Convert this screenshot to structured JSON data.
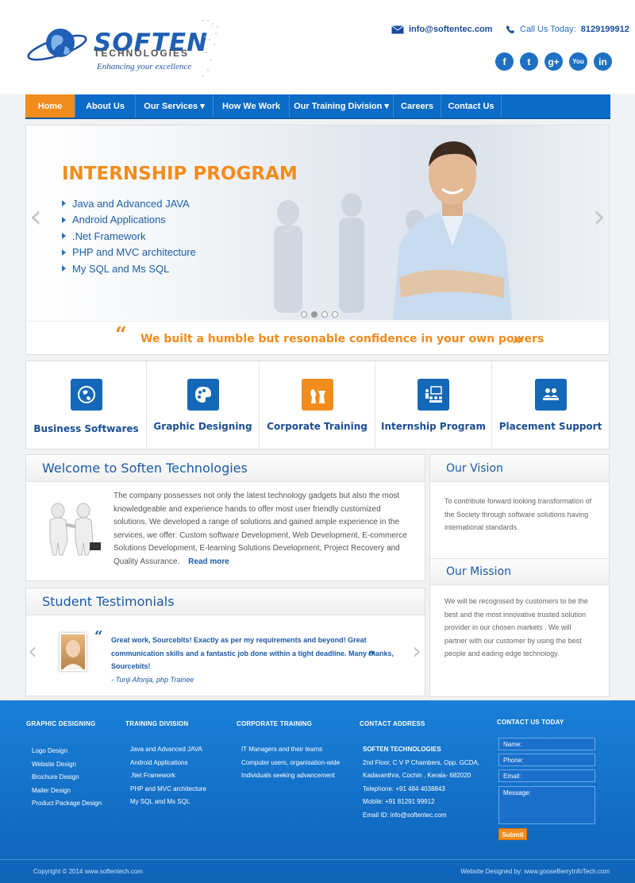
{
  "header": {
    "logo_name": "SOFTEN",
    "logo_sub": "TECHNOLOGIES",
    "logo_tagline": "Enhancing your excellence",
    "email": "info@softentec.com",
    "call_label": "Call Us Today:",
    "call_number": "8129199912",
    "social": [
      "f",
      "t",
      "g+",
      "You",
      "in"
    ]
  },
  "nav": {
    "items": [
      "Home",
      "About Us",
      "Our Services ▾",
      "How We Work",
      "Our Training Division ▾",
      "Careers",
      "Contact Us"
    ]
  },
  "slider": {
    "title": "INTERNSHIP PROGRAM",
    "items": [
      "Java and Advanced JAVA",
      "Android Applications",
      ".Net Framework",
      "PHP and MVC architecture",
      "My SQL and Ms SQL"
    ],
    "quote": "We built a humble but resonable confidence in your own powers"
  },
  "services": [
    {
      "label": "Business Softwares",
      "icon": "globe-icon"
    },
    {
      "label": "Graphic Designing",
      "icon": "palette-icon"
    },
    {
      "label": "Corporate Training",
      "icon": "chess-icon"
    },
    {
      "label": "Internship Program",
      "icon": "presentation-icon"
    },
    {
      "label": "Placement Support",
      "icon": "meeting-icon"
    }
  ],
  "welcome": {
    "title": "Welcome to Soften Technologies",
    "text": "The company possesses not only the latest technology gadgets but also the most knowledgeable and experience hands to offer most user friendly customized solutions. We developed a range of solutions and gained ample experience in the services, we offer: Custom software Development, Web Development, E-commerce Solutions Development, E-learning Solutions Development, Project Recovery and Quality Assurance.",
    "read_more": "Read more"
  },
  "testimonials": {
    "title": "Student Testimonials",
    "quote": "Great work, Sourcebits! Exactly as per my requirements and beyond! Great communication skills and a fantastic job done within a tight deadline. Many thanks, Sourcebits!",
    "author": "- Tunji Afonja, php Trainee"
  },
  "vision": {
    "title": "Our Vision",
    "text": "To contribute forward looking transformation of the Society through software solutions having international standards."
  },
  "mission": {
    "title": "Our Mission",
    "text": "We will be recognised by customers to be the best and the most innovative trusted solution provider in our chosen markets . We will partner with our customer by using the best people and eading edge technology."
  },
  "footer": {
    "graphic": {
      "title": "GRAPHIC DESIGNING",
      "items": [
        "Logo Design",
        "Website Design",
        "Brochure Design",
        "Mailer Design",
        "Product Package Design"
      ]
    },
    "training": {
      "title": "TRAINING DIVISION",
      "items": [
        "Java and Advanced JAVA",
        "Android Applications",
        ".Net Framework",
        "PHP and MVC architecture",
        "My SQL and Ms SQL"
      ]
    },
    "corporate": {
      "title": "CORPORATE TRAINING",
      "items": [
        "IT Managers and their teams",
        "Computer users, organisation-wide",
        "Individuals seeking advancement"
      ]
    },
    "contact": {
      "title": "CONTACT ADDRESS",
      "items": [
        "SOFTEN TECHNOLOGIES",
        "2nd Floor, C V P Chambers,  Opp. GCDA,",
        "Kadavanthra, Cochin , Kerala- 682020",
        "Telephone: +91 484 4038843",
        "Mobile: +91 81291 99912",
        "Email ID: info@softentec.com"
      ]
    },
    "form": {
      "title": "CONTACT US TODAY",
      "name": "Name:",
      "phone": "Phone:",
      "email": "Email:",
      "message": "Message:",
      "submit": "Submit"
    },
    "copyright": "Copyright  © 2014    www.softentech.com",
    "designed_by": "Website Designed by: www.gooseBerryInfoTech.com"
  },
  "colors": {
    "brand_blue": "#0b6bc6",
    "accent_orange": "#f28c1c"
  }
}
